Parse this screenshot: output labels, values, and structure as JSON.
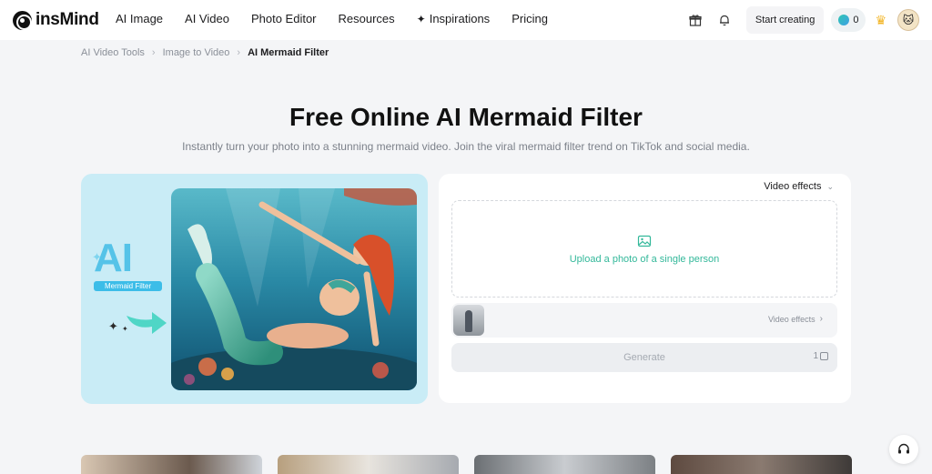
{
  "header": {
    "brand": "insMind",
    "nav": [
      "AI Image",
      "AI Video",
      "Photo Editor",
      "Resources",
      "Inspirations",
      "Pricing"
    ],
    "start_label": "Start creating",
    "credits": "0",
    "icons": [
      "gift-icon",
      "bell-icon",
      "coin-icon",
      "crown-icon",
      "avatar"
    ]
  },
  "breadcrumb": [
    "AI Video Tools",
    "Image to Video",
    "AI Mermaid Filter"
  ],
  "hero": {
    "title": "Free Online AI Mermaid Filter",
    "subtitle": "Instantly turn your photo into a stunning mermaid video. Join the viral mermaid filter trend on TikTok and social media."
  },
  "demo": {
    "badge": "AI",
    "tag": "Mermaid Filter"
  },
  "panel": {
    "effects_select": "Video effects",
    "upload_text": "Upload a photo of a single person",
    "effect_row_label": "Video effects",
    "generate_label": "Generate",
    "generate_cost": "1"
  },
  "colors": {
    "accent": "#33b89a",
    "demo_bg": "#c9ecf6",
    "page_bg": "#f4f5f7"
  }
}
